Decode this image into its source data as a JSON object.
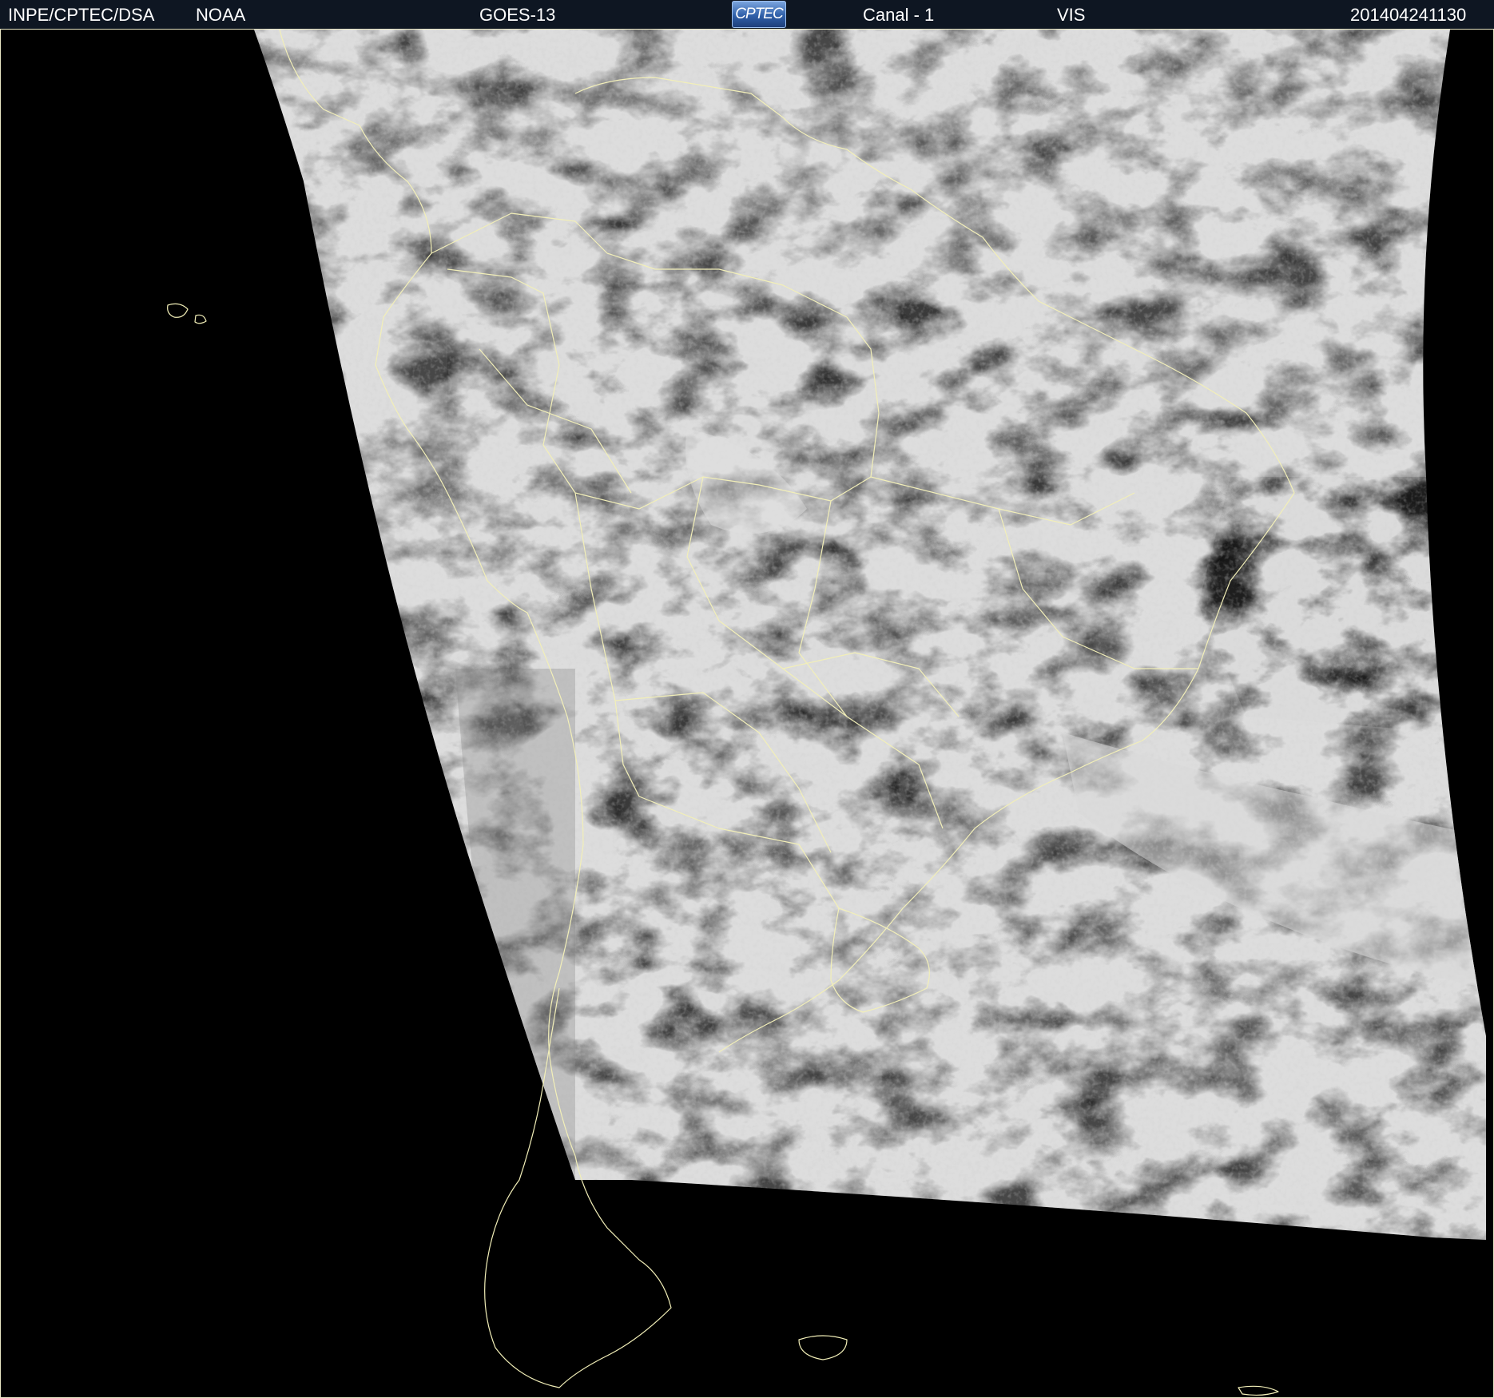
{
  "header": {
    "agency": "INPE/CPTEC/DSA",
    "source": "NOAA",
    "satellite": "GOES-13",
    "logo_text": "CPTEC",
    "channel": "Canal - 1",
    "band": "VIS",
    "timestamp": "201404241130"
  },
  "colors": {
    "background": "#000000",
    "header_bg": "#0e1622",
    "coastline": "#f2efb8",
    "cloud_bright": "#e6e6e6",
    "ocean_gray": "#4a4a4a"
  },
  "icons": {
    "logo": "cptec-logo"
  }
}
